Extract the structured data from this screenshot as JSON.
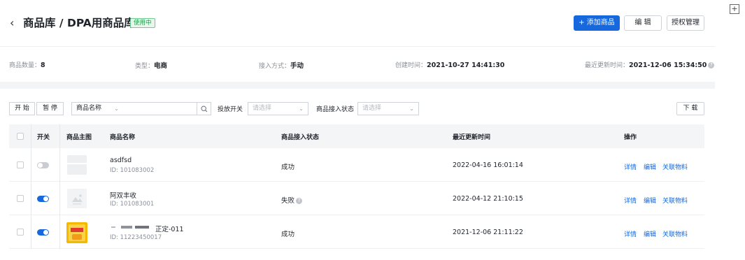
{
  "header": {
    "back_icon": "chevron-left-icon",
    "title": "商品库 / DPA用商品库",
    "badge": "使用中",
    "add_button": "+ 添加商品",
    "edit_button": "编 辑",
    "auth_button": "授权管理"
  },
  "info": {
    "count_label": "商品数量：",
    "count_value": "8",
    "type_label": "类型：",
    "type_value": "电商",
    "access_label": "接入方式：",
    "access_value": "手动",
    "created_label": "创建时间：",
    "created_value": "2021-10-27 14:41:30",
    "updated_label": "最近更新时间：",
    "updated_value": "2021-12-06 15:34:50"
  },
  "toolbar": {
    "start": "开 始",
    "pause": "暂 停",
    "search_field": "商品名称",
    "search_placeholder": "",
    "switch_label": "投放开关",
    "switch_placeholder": "请选择",
    "status_label": "商品接入状态",
    "status_placeholder": "请选择",
    "download": "下 载"
  },
  "table": {
    "columns": [
      "开关",
      "商品主图",
      "商品名称",
      "商品接入状态",
      "最近更新时间",
      "操作"
    ],
    "rows": [
      {
        "switch_on": false,
        "name": "asdfsd",
        "id": "ID: 101083002",
        "status": "成功",
        "updated": "2022-04-16 16:01:14",
        "actions": [
          "详情",
          "编辑",
          "关联物料"
        ]
      },
      {
        "switch_on": true,
        "name": "阿双丰收",
        "id": "ID: 101083001",
        "status": "失败",
        "updated": "2022-04-12 21:10:15",
        "actions": [
          "详情",
          "编辑",
          "关联物料"
        ]
      },
      {
        "switch_on": true,
        "name": "正定-011",
        "id": "ID: 11223450017",
        "status": "成功",
        "updated": "2021-12-06 21:11:22",
        "actions": [
          "详情",
          "编辑",
          "关联物料"
        ]
      }
    ]
  },
  "colors": {
    "primary": "#1668dc",
    "badge_green": "#1a9b4b",
    "header_bg": "#f3f5f7"
  }
}
